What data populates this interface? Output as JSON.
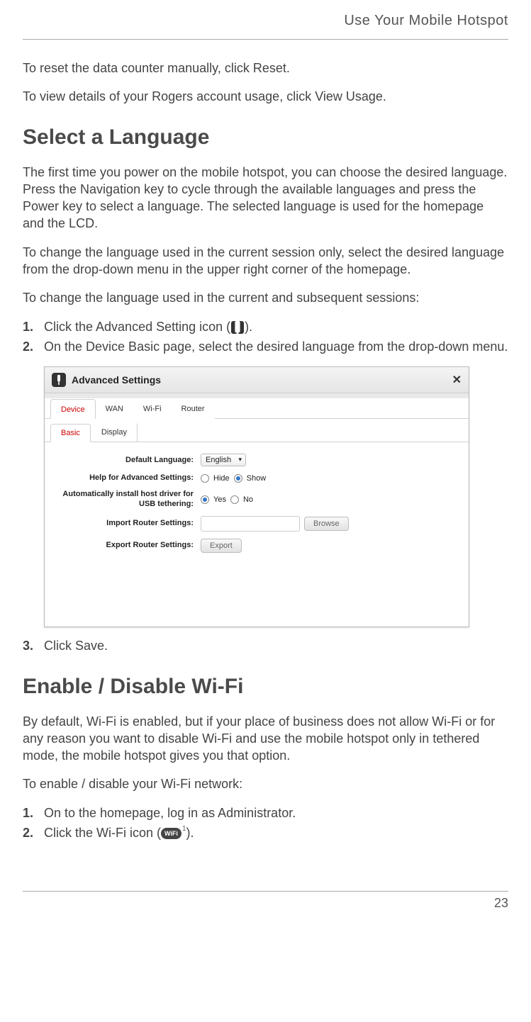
{
  "header": {
    "title": "Use Your Mobile Hotspot"
  },
  "intro": {
    "reset": "To reset the data counter manually, click Reset.",
    "usage": "To view details of your Rogers account usage, click View Usage."
  },
  "sections": {
    "lang": {
      "heading": "Select a Language",
      "p1": "The first time you power on the mobile hotspot, you can choose the desired language. Press the Navigation key to cycle through the available languages and press the Power key to select a language. The selected language is used for the homepage and the LCD.",
      "p2": "To change the language used in the current session only, select the desired language from the drop-down menu in the upper right corner of the homepage.",
      "p3": "To change the language used in the current and subsequent sessions:",
      "step1_pre": "Click the Advanced Setting icon (",
      "step1_post": ").",
      "step2": "On the Device Basic page, select the desired language from the drop-down menu.",
      "step3": "Click Save."
    },
    "wifi": {
      "heading": "Enable / Disable Wi-Fi",
      "p1": "By default, Wi-Fi is enabled, but if your place of business does not allow Wi-Fi or for any reason you want to disable Wi-Fi and use the mobile hotspot only in tethered mode, the mobile hotspot gives you that option.",
      "p2": "To enable / disable your Wi-Fi network:",
      "step1": "On to the homepage, log in as Administrator.",
      "step2_pre": "Click the Wi-Fi icon (",
      "step2_post": ")."
    }
  },
  "adv": {
    "title": "Advanced Settings",
    "tabs": [
      "Device",
      "WAN",
      "Wi-Fi",
      "Router"
    ],
    "active_tab": 0,
    "subtabs": [
      "Basic",
      "Display"
    ],
    "active_subtab": 0,
    "rows": {
      "default_language": {
        "label": "Default Language:",
        "value": "English"
      },
      "help": {
        "label": "Help for Advanced Settings:",
        "options": [
          "Hide",
          "Show"
        ],
        "selected": 1
      },
      "auto_install": {
        "label": "Automatically install host driver for USB tethering:",
        "options": [
          "Yes",
          "No"
        ],
        "selected": 0
      },
      "import_settings": {
        "label": "Import Router Settings:",
        "button": "Browse"
      },
      "export_settings": {
        "label": "Export Router Settings:",
        "button": "Export"
      }
    }
  },
  "icons": {
    "wifi_badge": "WiFi",
    "wifi_sup": "1"
  },
  "page_number": "23"
}
